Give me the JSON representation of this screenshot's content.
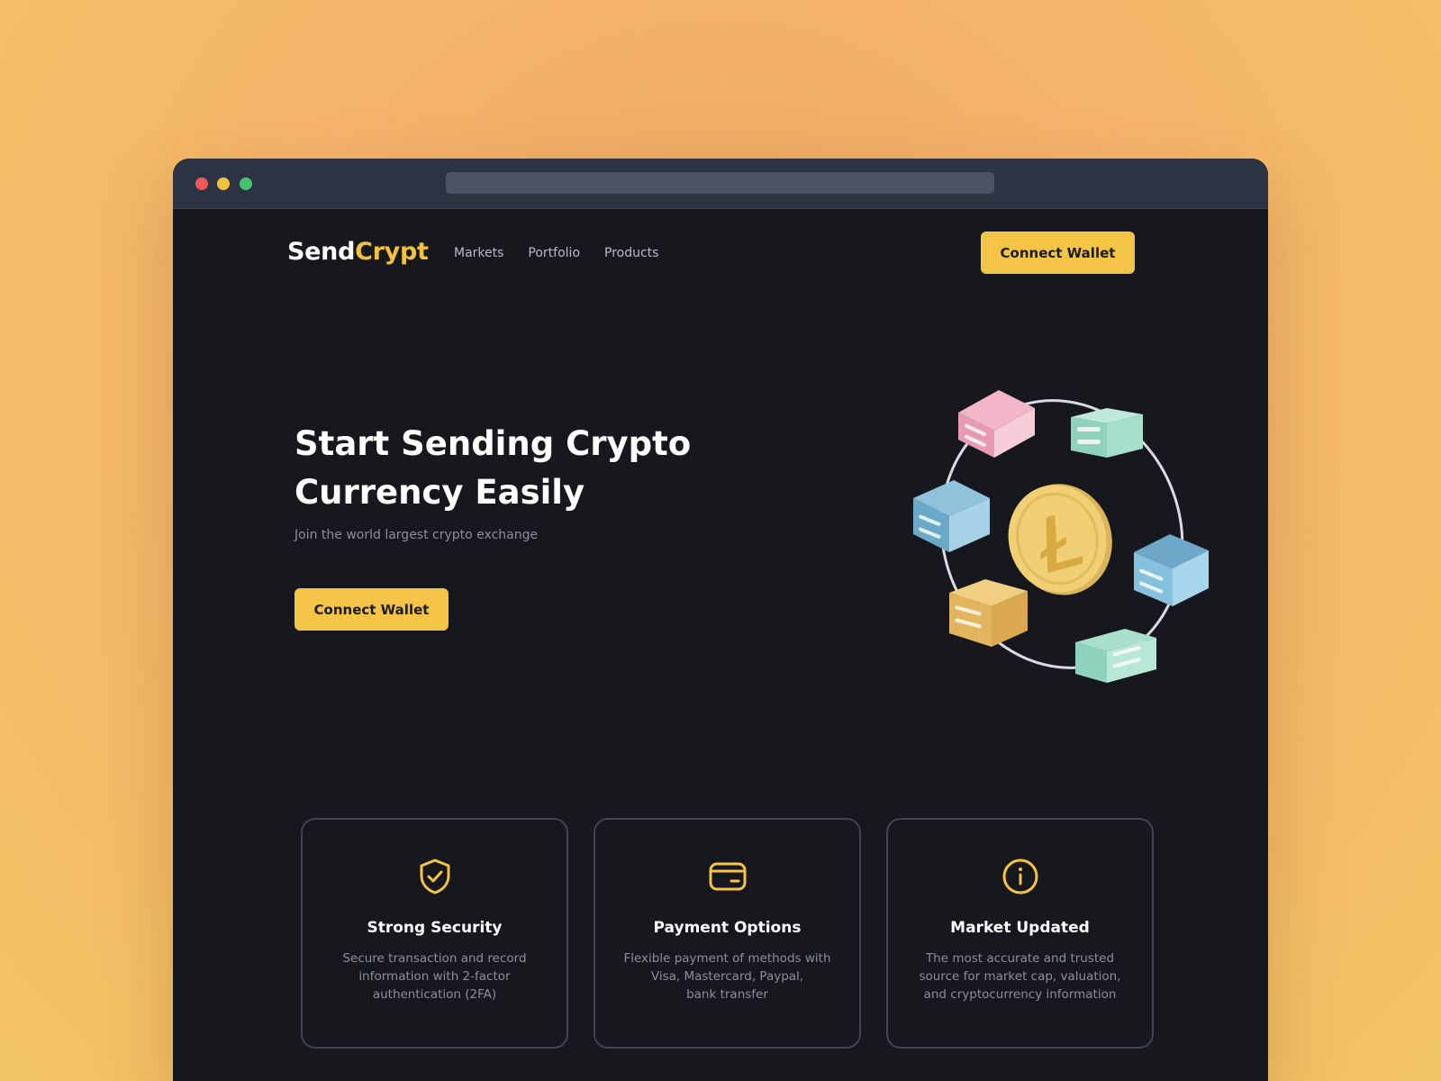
{
  "brand": {
    "name_part1": "Send",
    "name_part2": "Crypt",
    "accent_color": "#f4c446"
  },
  "nav": {
    "links": [
      "Markets",
      "Portfolio",
      "Products"
    ],
    "cta_label": "Connect Wallet"
  },
  "hero": {
    "title": "Start Sending Crypto Currency Easily",
    "subtitle": "Join the world largest crypto exchange",
    "cta_label": "Connect Wallet",
    "illustration_icon": "litecoin-network-illustration"
  },
  "features": [
    {
      "icon": "shield-check-icon",
      "title": "Strong Security",
      "description": "Secure transaction and record\ninformation with 2-factor\nauthentication (2FA)"
    },
    {
      "icon": "credit-card-icon",
      "title": "Payment Options",
      "description": "Flexible payment of methods with\nVisa, Mastercard, Paypal,\nbank transfer"
    },
    {
      "icon": "info-icon",
      "title": "Market Updated",
      "description": "The most accurate and trusted\nsource for market cap, valuation,\nand cryptocurrency information"
    }
  ]
}
